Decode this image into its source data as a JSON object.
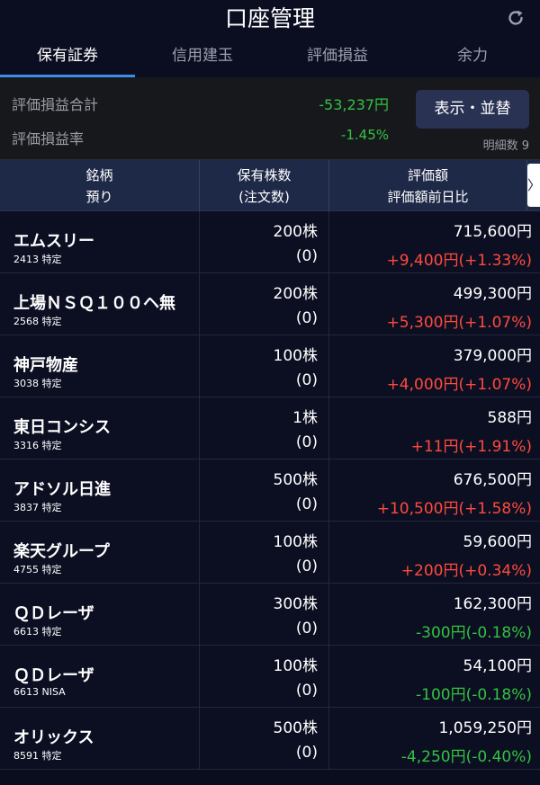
{
  "header": {
    "title": "口座管理",
    "refresh_icon": "refresh-icon"
  },
  "tabs": [
    {
      "label": "保有証券",
      "active": true
    },
    {
      "label": "信用建玉",
      "active": false
    },
    {
      "label": "評価損益",
      "active": false
    },
    {
      "label": "余力",
      "active": false
    }
  ],
  "summary": {
    "total_label": "評価損益合計",
    "total_value": "-53,237円",
    "rate_label": "評価損益率",
    "rate_value": "-1.45%",
    "sort_button": "表示・並替",
    "detail_count": "明細数 9"
  },
  "columns": {
    "c1_top": "銘柄",
    "c1_bottom": "預り",
    "c2_top": "保有株数",
    "c2_bottom": "(注文数)",
    "c3_top": "評価額",
    "c3_bottom": "評価額前日比",
    "scroll_glyph": "〉"
  },
  "colors": {
    "positive": "#ff4a3d",
    "negative": "#33c241",
    "accent": "#3a8ee6"
  },
  "holdings": [
    {
      "name": "エムスリー",
      "code": "2413 特定",
      "qty": "200株",
      "order": "(0)",
      "value": "715,600円",
      "change": "+9,400円(+1.33%)",
      "sign": "pos"
    },
    {
      "name": "上場ＮＳＱ１００ヘ無",
      "code": "2568 特定",
      "qty": "200株",
      "order": "(0)",
      "value": "499,300円",
      "change": "+5,300円(+1.07%)",
      "sign": "pos"
    },
    {
      "name": "神戸物産",
      "code": "3038 特定",
      "qty": "100株",
      "order": "(0)",
      "value": "379,000円",
      "change": "+4,000円(+1.07%)",
      "sign": "pos"
    },
    {
      "name": "東日コンシス",
      "code": "3316 特定",
      "qty": "1株",
      "order": "(0)",
      "value": "588円",
      "change": "+11円(+1.91%)",
      "sign": "pos"
    },
    {
      "name": "アドソル日進",
      "code": "3837 特定",
      "qty": "500株",
      "order": "(0)",
      "value": "676,500円",
      "change": "+10,500円(+1.58%)",
      "sign": "pos"
    },
    {
      "name": "楽天グループ",
      "code": "4755 特定",
      "qty": "100株",
      "order": "(0)",
      "value": "59,600円",
      "change": "+200円(+0.34%)",
      "sign": "pos"
    },
    {
      "name": "ＱＤレーザ",
      "code": "6613 特定",
      "qty": "300株",
      "order": "(0)",
      "value": "162,300円",
      "change": "-300円(-0.18%)",
      "sign": "neg"
    },
    {
      "name": "ＱＤレーザ",
      "code": "6613 NISA",
      "qty": "100株",
      "order": "(0)",
      "value": "54,100円",
      "change": "-100円(-0.18%)",
      "sign": "neg"
    },
    {
      "name": "オリックス",
      "code": "8591 特定",
      "qty": "500株",
      "order": "(0)",
      "value": "1,059,250円",
      "change": "-4,250円(-0.40%)",
      "sign": "neg"
    }
  ]
}
